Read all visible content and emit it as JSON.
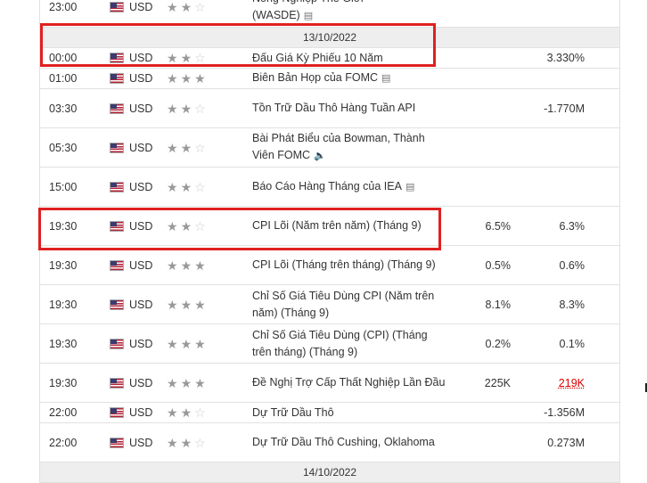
{
  "currency": "USD",
  "dates": [
    "13/10/2022",
    "14/10/2022"
  ],
  "top_row": {
    "time": "23:00",
    "event_line1": "Nông Nghiệp Thế Giới",
    "event_line2": "(WASDE)"
  },
  "rows": [
    {
      "time": "00:00",
      "event": "Đấu Giá Kỳ Phiếu 10 Năm",
      "actual": "",
      "forecast": "",
      "previous": "3.330%",
      "importance": 2,
      "icon": ""
    },
    {
      "time": "01:00",
      "event": "Biên Bản Họp của FOMC",
      "actual": "",
      "forecast": "",
      "previous": "",
      "importance": 3,
      "icon": "document"
    },
    {
      "time": "03:30",
      "event": "Tồn Trữ Dầu Thô Hàng Tuần API",
      "actual": "",
      "forecast": "",
      "previous": "-1.770M",
      "importance": 2,
      "icon": ""
    },
    {
      "time": "05:30",
      "event": "Bài Phát Biểu của Bowman, Thành Viên FOMC",
      "actual": "",
      "forecast": "",
      "previous": "",
      "importance": 2,
      "icon": "speaker"
    },
    {
      "time": "15:00",
      "event": "Báo Cáo Hàng Tháng của IEA",
      "actual": "",
      "forecast": "",
      "previous": "",
      "importance": 2,
      "icon": "document"
    },
    {
      "time": "19:30",
      "event": "CPI Lõi (Năm trên năm) (Tháng 9)",
      "actual": "",
      "forecast": "6.5%",
      "previous": "6.3%",
      "importance": 2,
      "icon": ""
    },
    {
      "time": "19:30",
      "event": "CPI Lõi (Tháng trên tháng) (Tháng 9)",
      "actual": "",
      "forecast": "0.5%",
      "previous": "0.6%",
      "importance": 3,
      "icon": ""
    },
    {
      "time": "19:30",
      "event": "Chỉ Số Giá Tiêu Dùng CPI (Năm trên năm) (Tháng 9)",
      "actual": "",
      "forecast": "8.1%",
      "previous": "8.3%",
      "importance": 3,
      "icon": ""
    },
    {
      "time": "19:30",
      "event": "Chỉ Số Giá Tiêu Dùng (CPI) (Tháng trên tháng) (Tháng 9)",
      "actual": "",
      "forecast": "0.2%",
      "previous": "0.1%",
      "importance": 3,
      "icon": ""
    },
    {
      "time": "19:30",
      "event": "Đề Nghị Trợ Cấp Thất Nghiệp Lần Đầu",
      "actual": "",
      "forecast": "225K",
      "previous": "219K",
      "importance": 3,
      "icon": "",
      "previous_color": "#dd0000"
    },
    {
      "time": "22:00",
      "event": "Dự Trữ Dầu Thô",
      "actual": "",
      "forecast": "",
      "previous": "-1.356M",
      "importance": 2,
      "icon": ""
    },
    {
      "time": "22:00",
      "event": "Dự Trữ Dầu Thô Cushing, Oklahoma",
      "actual": "",
      "forecast": "",
      "previous": "0.273M",
      "importance": 2,
      "icon": ""
    }
  ]
}
